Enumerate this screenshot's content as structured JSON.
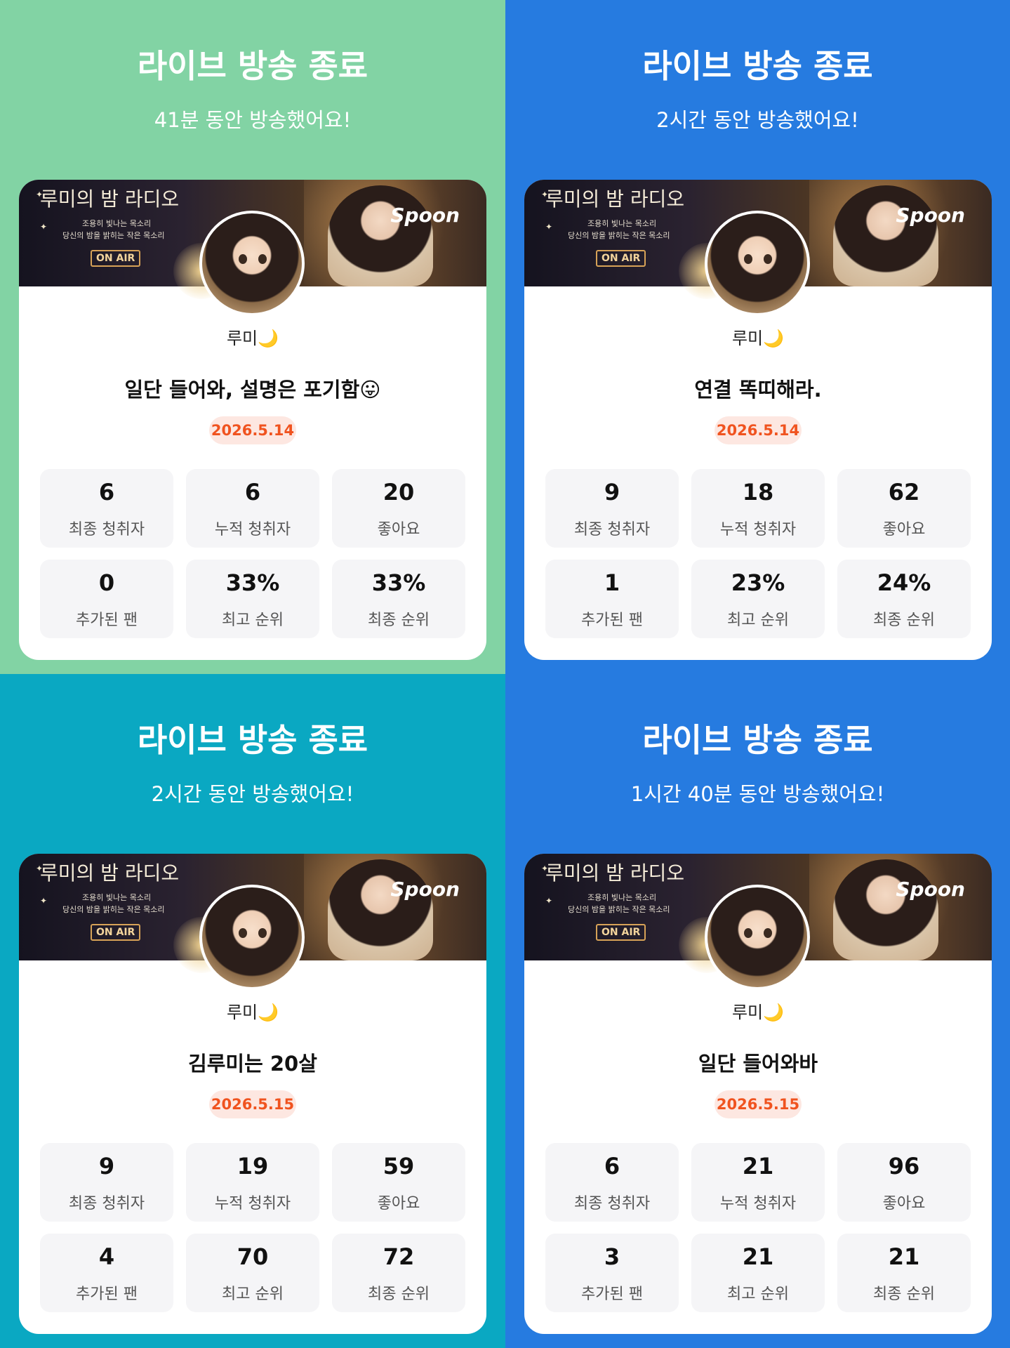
{
  "labels": {
    "final_listeners": "최종 청취자",
    "total_listeners": "누적 청취자",
    "likes": "좋아요",
    "new_fans": "추가된 팬",
    "best_rank": "최고 순위",
    "final_rank": "최종 순위"
  },
  "banner": {
    "headline": "루미의 밤 라디오",
    "subtitle_1": "조용히 빛나는 목소리",
    "subtitle_2": "당신의 밤을 밝히는 작은 목소리",
    "on_air": "ON AIR",
    "brand": "Spoon"
  },
  "colors": {
    "green": "#82d3a4",
    "blue": "#267be0",
    "teal": "#0aa8c2",
    "date_text": "#f0531f",
    "date_bg": "#fde7e1"
  },
  "panels": [
    {
      "bg": "#82d3a4",
      "title": "라이브 방송 종료",
      "duration": "41분 동안 방송했어요!",
      "nickname": "루미🌙",
      "live_title": "일단 들어와, 설명은 포기함😛",
      "date": "2026.5.14",
      "stats": {
        "final_listeners": "6",
        "total_listeners": "6",
        "likes": "20",
        "new_fans": "0",
        "best_rank": "33%",
        "final_rank": "33%"
      }
    },
    {
      "bg": "#267be0",
      "title": "라이브 방송 종료",
      "duration": "2시간 동안 방송했어요!",
      "nickname": "루미🌙",
      "live_title": "연결 똑띠해라.",
      "date": "2026.5.14",
      "stats": {
        "final_listeners": "9",
        "total_listeners": "18",
        "likes": "62",
        "new_fans": "1",
        "best_rank": "23%",
        "final_rank": "24%"
      }
    },
    {
      "bg": "#0aa8c2",
      "title": "라이브 방송 종료",
      "duration": "2시간 동안 방송했어요!",
      "nickname": "루미🌙",
      "live_title": "김루미는 20살",
      "date": "2026.5.15",
      "stats": {
        "final_listeners": "9",
        "total_listeners": "19",
        "likes": "59",
        "new_fans": "4",
        "best_rank": "70",
        "final_rank": "72"
      }
    },
    {
      "bg": "#267be0",
      "title": "라이브 방송 종료",
      "duration": "1시간 40분 동안 방송했어요!",
      "nickname": "루미🌙",
      "live_title": "일단 들어와바",
      "date": "2026.5.15",
      "stats": {
        "final_listeners": "6",
        "total_listeners": "21",
        "likes": "96",
        "new_fans": "3",
        "best_rank": "21",
        "final_rank": "21"
      }
    }
  ]
}
